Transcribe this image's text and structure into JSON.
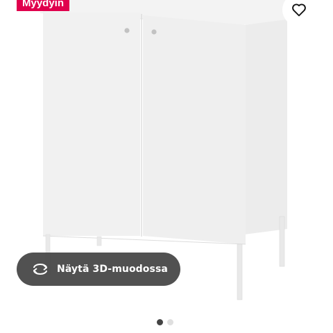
{
  "badge": {
    "label": "Myydyin"
  },
  "favourite": {
    "icon": "heart-icon"
  },
  "view3d": {
    "label": "Näytä 3D-muodossa",
    "icon": "rotate-3d-icon"
  },
  "image": {
    "subject": "sink-cabinet"
  },
  "pager": {
    "count": 2,
    "active": 1
  },
  "colors": {
    "badge": "#e0004d",
    "pill": "#484848",
    "dot_active": "#444444",
    "dot_inactive": "#dfdfdf"
  }
}
